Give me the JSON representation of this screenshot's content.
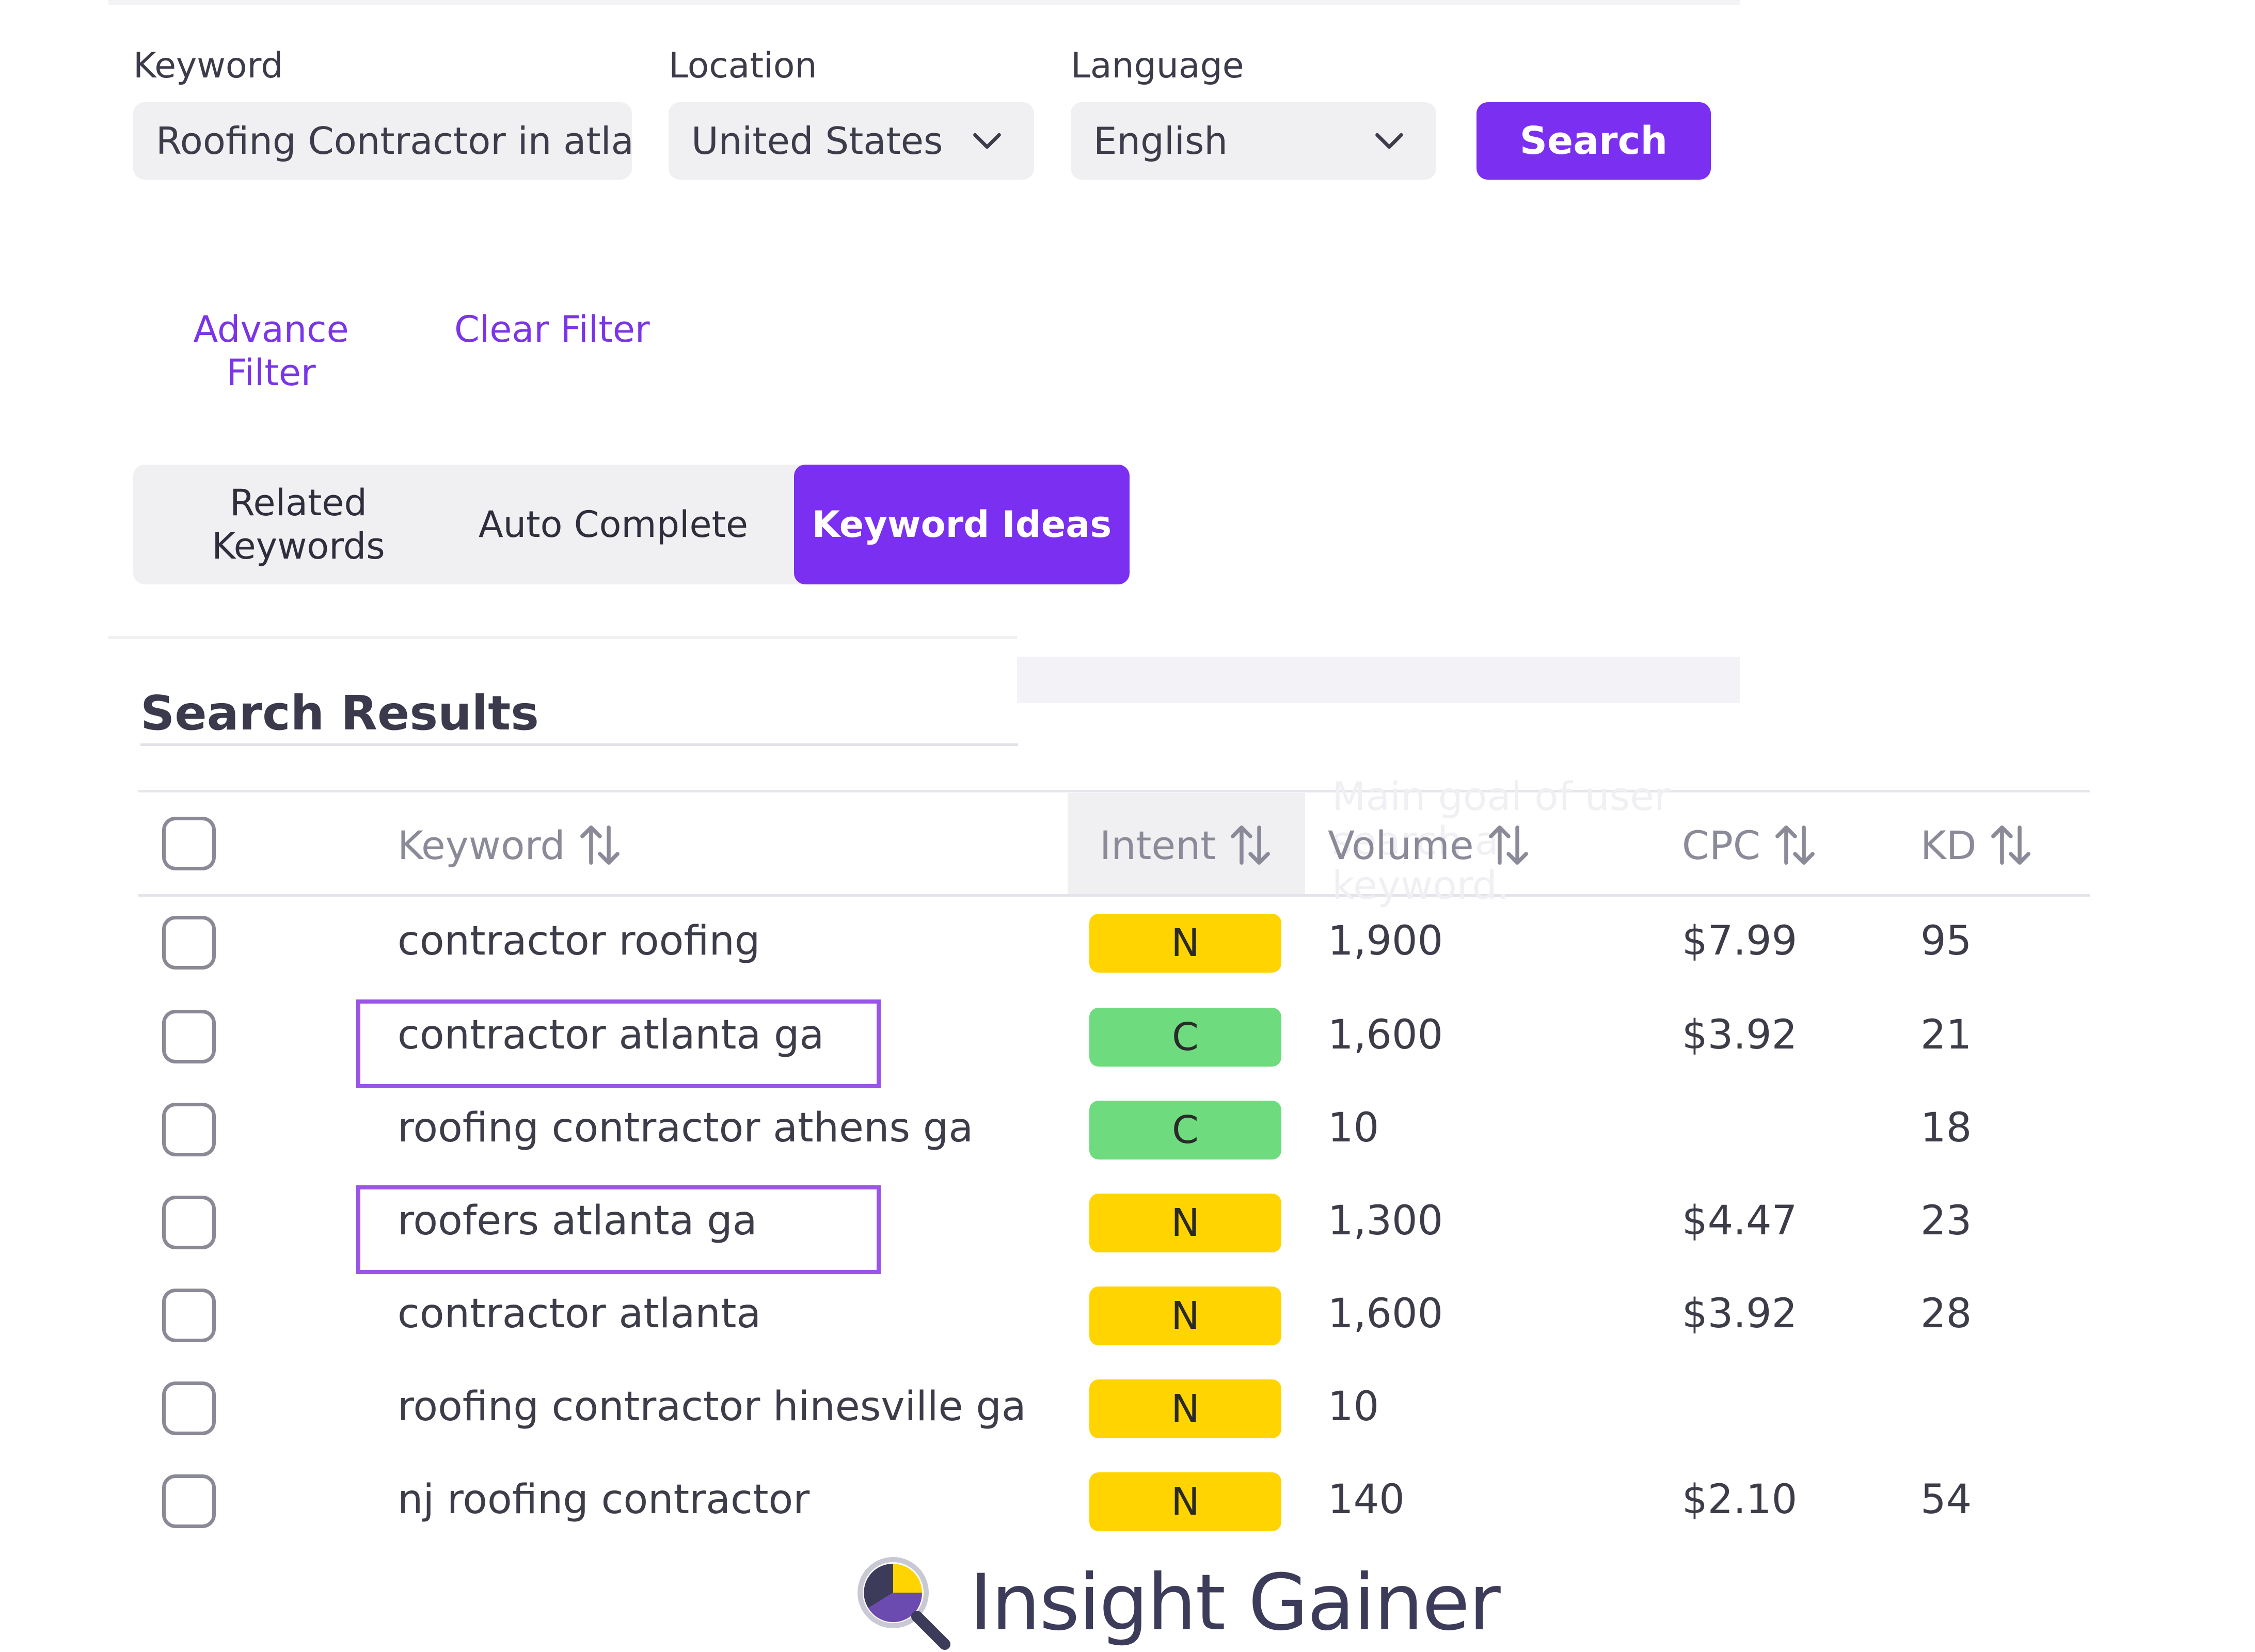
{
  "form": {
    "keyword_label": "Keyword",
    "keyword_value": "Roofing Contractor in atlan",
    "location_label": "Location",
    "location_value": "United States",
    "language_label": "Language",
    "language_value": "English",
    "search_label": "Search"
  },
  "filters": {
    "advance_line1": "Advance",
    "advance_line2": "Filter",
    "clear": "Clear Filter"
  },
  "tabs": [
    {
      "line1": "Related",
      "line2": "Keywords",
      "active": false
    },
    {
      "line1": "Auto Complete",
      "line2": "",
      "active": false
    },
    {
      "line1": "Keyword Ideas",
      "line2": "",
      "active": true
    }
  ],
  "results": {
    "title": "Search Results",
    "headers": {
      "keyword": "Keyword",
      "intent": "Intent",
      "volume": "Volume",
      "cpc": "CPC",
      "kd": "KD"
    },
    "rows": [
      {
        "keyword": "contractor roofing",
        "intent": "N",
        "volume": "1,900",
        "cpc": "$7.99",
        "kd": "95"
      },
      {
        "keyword": "contractor atlanta ga",
        "intent": "C",
        "volume": "1,600",
        "cpc": "$3.92",
        "kd": "21"
      },
      {
        "keyword": "roofing contractor athens ga",
        "intent": "C",
        "volume": "10",
        "cpc": "",
        "kd": "18"
      },
      {
        "keyword": "roofers atlanta ga",
        "intent": "N",
        "volume": "1,300",
        "cpc": "$4.47",
        "kd": "23"
      },
      {
        "keyword": "contractor atlanta",
        "intent": "N",
        "volume": "1,600",
        "cpc": "$3.92",
        "kd": "28"
      },
      {
        "keyword": "roofing contractor hinesville ga",
        "intent": "N",
        "volume": "10",
        "cpc": "",
        "kd": ""
      },
      {
        "keyword": "nj roofing contractor",
        "intent": "N",
        "volume": "140",
        "cpc": "$2.10",
        "kd": "54"
      }
    ]
  },
  "ghost_tooltip": {
    "line1": "Main goal of user",
    "line2": "search a",
    "line3": "keyword."
  },
  "colors": {
    "accent": "#7b2ff0",
    "intent_N": "#ffd400",
    "intent_C": "#6edc7e",
    "highlight": "#9b55e6"
  },
  "logo": {
    "text": "Insight Gainer",
    "icon": "magnifier-pie-icon"
  }
}
